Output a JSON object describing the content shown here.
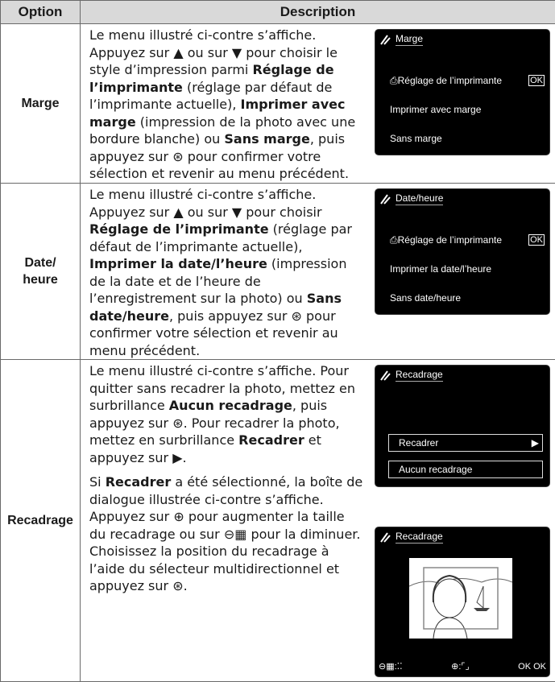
{
  "header": {
    "option": "Option",
    "description": "Description"
  },
  "rows": [
    {
      "option_line1": "Marge",
      "text": [
        {
          "t": "Le menu illustré ci-contre s’affiche. Appuyez sur ▲ ou sur ▼ pour choisir le style d’impression parmi ",
          "b": false
        },
        {
          "t": "Réglage de l’imprimante",
          "b": true
        },
        {
          "t": " (réglage par défaut de l’imprimante actuelle), ",
          "b": false
        },
        {
          "t": "Imprimer avec marge",
          "b": true
        },
        {
          "t": " (impression de la photo avec une bordure blanche) ou ",
          "b": false
        },
        {
          "t": "Sans marge",
          "b": true
        },
        {
          "t": ", puis appuyez sur ⊛ pour confirmer votre sélection et revenir au menu précédent.",
          "b": false
        }
      ],
      "screen": {
        "title": "Marge",
        "items": [
          "⎙Réglage de l’imprimante",
          "Imprimer avec marge",
          "Sans marge"
        ],
        "ok": "OK"
      }
    },
    {
      "option_line1": "Date/",
      "option_line2": "heure",
      "text": [
        {
          "t": "Le menu illustré ci-contre s’affiche. Appuyez sur ▲ ou sur ▼ pour choisir ",
          "b": false
        },
        {
          "t": "Réglage de l’imprimante",
          "b": true
        },
        {
          "t": " (réglage par défaut de l’imprimante actuelle), ",
          "b": false
        },
        {
          "t": "Imprimer la date/l’heure",
          "b": true
        },
        {
          "t": " (impression de la date et de l’heure de l’enregistrement sur la photo) ou ",
          "b": false
        },
        {
          "t": "Sans date/heure",
          "b": true
        },
        {
          "t": ", puis appuyez sur ⊛ pour confirmer votre sélection et revenir au menu précédent.",
          "b": false
        }
      ],
      "screen": {
        "title": "Date/heure",
        "items": [
          "⎙Réglage de l’imprimante",
          "Imprimer la date/l’heure",
          "Sans date/heure"
        ],
        "ok": "OK"
      }
    },
    {
      "option_line1": "Recadrage",
      "text1": [
        {
          "t": "Le menu illustré ci-contre s’affiche. Pour quitter sans recadrer la photo, mettez en surbrillance ",
          "b": false
        },
        {
          "t": "Aucun recadrage",
          "b": true
        },
        {
          "t": ", puis appuyez sur ⊛. Pour recadrer la photo, mettez en surbrillance ",
          "b": false
        },
        {
          "t": "Recadrer",
          "b": true
        },
        {
          "t": " et appuyez sur ▶.",
          "b": false
        }
      ],
      "text2": [
        {
          "t": "Si ",
          "b": false
        },
        {
          "t": "Recadrer",
          "b": true
        },
        {
          "t": " a été sélectionné, la boîte de dialogue illustrée ci-contre s’affiche. Appuyez sur ⊕ pour augmenter la taille du recadrage ou sur ⊖▦ pour la diminuer. Choisissez la position du recadrage à l’aide du sélecteur multidirectionnel et appuyez sur ⊛.",
          "b": false
        }
      ],
      "screen1": {
        "title": "Recadrage",
        "items": [
          "Recadrer",
          "Aucun recadrage"
        ]
      },
      "screen2": {
        "title": "Recadrage",
        "bar": [
          "⊖▦:⁚⁚",
          "⊕:⌜⌟",
          "OK OK"
        ]
      }
    }
  ]
}
